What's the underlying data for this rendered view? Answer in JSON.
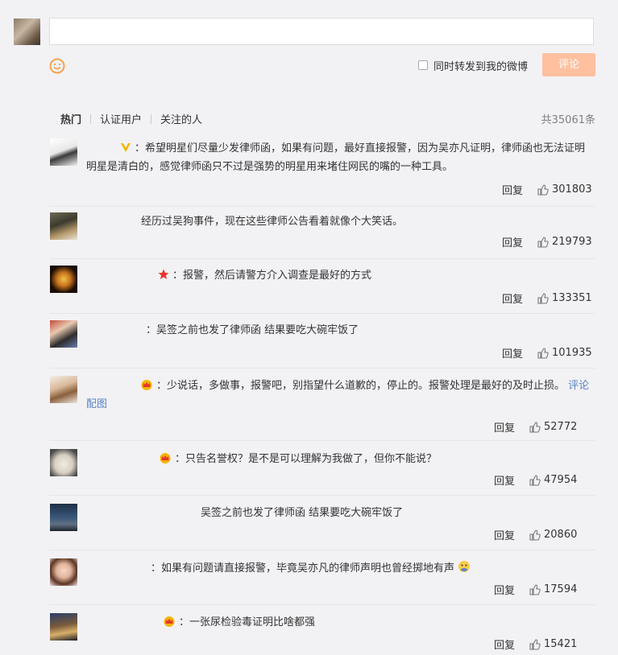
{
  "compose": {
    "input_value": "",
    "repost_label": "同时转发到我的微博",
    "submit_label": "评论"
  },
  "tabs": [
    {
      "label": "热门"
    },
    {
      "label": "认证用户"
    },
    {
      "label": "关注的人"
    }
  ],
  "total_count": "共35061条",
  "reply_label": "回复",
  "comments": [
    {
      "text": "：希望明星们尽量少发律师函，如果有问题，最好直接报警，因为吴亦凡证明，律师函也无法证明明星是清白的，感觉律师函只不过是强势的明星用来堵住网民的嘴的一种工具。",
      "likes": "301803",
      "badge": "v-icon"
    },
    {
      "text": "经历过吴狗事件，现在这些律师公告看着就像个大笑话。",
      "likes": "219793",
      "badge": ""
    },
    {
      "text": "：报警，然后请警方介入调查是最好的方式",
      "likes": "133351",
      "badge": "star-icon"
    },
    {
      "text": "：吴签之前也发了律师函 结果要吃大碗牢饭了",
      "likes": "101935",
      "badge": ""
    },
    {
      "text": "：少说话，多做事，报警吧，别指望什么道歉的，停止的。报警处理是最好的及时止损。",
      "link1": "评论",
      "link2": "配图",
      "likes": "52772",
      "badge": "crown-icon"
    },
    {
      "text": "：只告名誉权？是不是可以理解为我做了，但你不能说？",
      "likes": "47954",
      "badge": "crown-icon"
    },
    {
      "text": "吴签之前也发了律师函 结果要吃大碗牢饭了",
      "likes": "20860",
      "badge": ""
    },
    {
      "text": "：如果有问题请直接报警，毕竟吴亦凡的律师声明也曾经掷地有声",
      "likes": "17594",
      "badge": ""
    },
    {
      "text": "：一张尿检验毒证明比啥都强",
      "likes": "15421",
      "badge": "crown-icon"
    }
  ]
}
